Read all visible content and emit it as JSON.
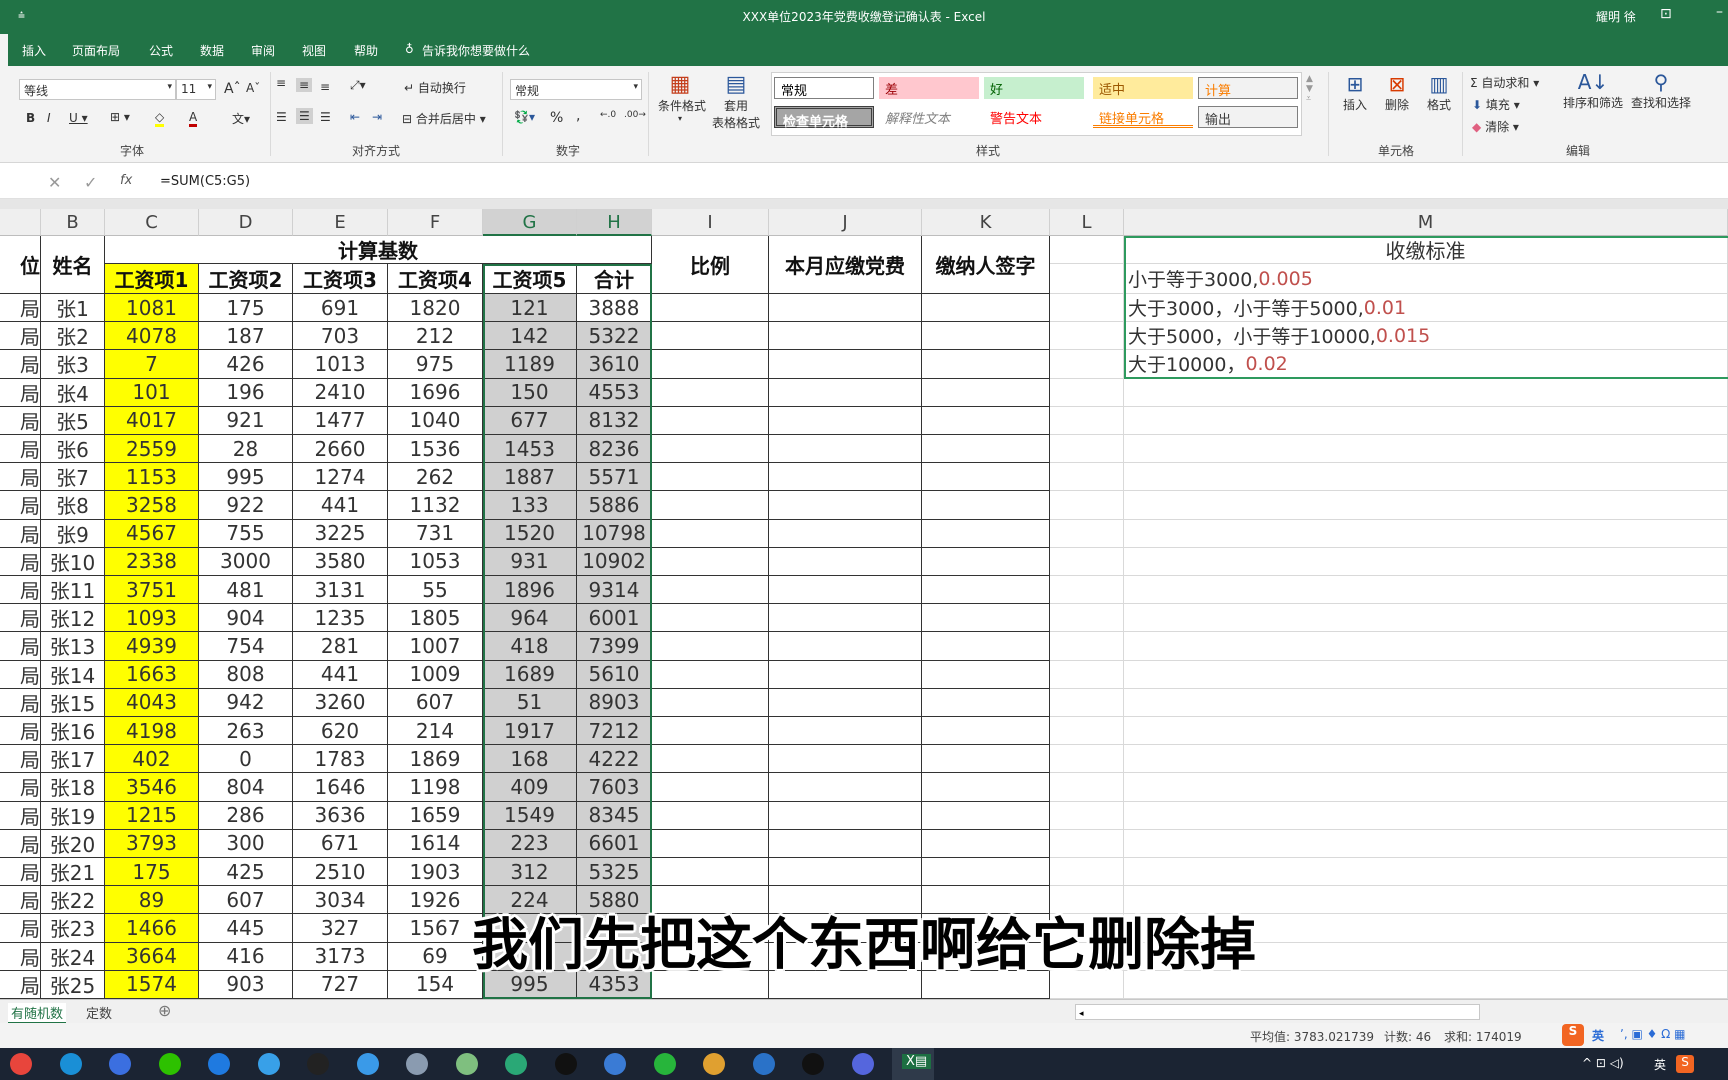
{
  "window": {
    "title": "XXX单位2023年党费收缴登记确认表  -  Excel",
    "user": "耀明 徐",
    "qat": "⩮"
  },
  "tabs": [
    "插入",
    "页面布局",
    "公式",
    "数据",
    "审阅",
    "视图",
    "帮助"
  ],
  "tell_me": "告诉我你想要做什么",
  "ribbon": {
    "font_name": "等线",
    "font_size": "11",
    "wrap_text": "自动换行",
    "merge_center": "合并后居中",
    "number_format": "常规",
    "cond_format": "条件格式",
    "table_format_1": "套用",
    "table_format_2": "表格格式",
    "styles": [
      {
        "label": "常规",
        "bg": "#ffffff",
        "fg": "#000000"
      },
      {
        "label": "差",
        "bg": "#ffc7ce",
        "fg": "#9c0006"
      },
      {
        "label": "好",
        "bg": "#c6efce",
        "fg": "#006100"
      },
      {
        "label": "适中",
        "bg": "#ffeb9c",
        "fg": "#9c5700"
      },
      {
        "label": "计算",
        "bg": "#f2f2f2",
        "fg": "#fa7d00"
      },
      {
        "label": "检查单元格",
        "bg": "#a5a5a5",
        "fg": "#ffffff"
      },
      {
        "label": "解释性文本",
        "bg": "#ffffff",
        "fg": "#7f7f7f"
      },
      {
        "label": "警告文本",
        "bg": "#ffffff",
        "fg": "#ff0000"
      },
      {
        "label": "链接单元格",
        "bg": "#ffffff",
        "fg": "#fa7d00"
      },
      {
        "label": "输出",
        "bg": "#f2f2f2",
        "fg": "#3f3f3f"
      }
    ],
    "insert": "插入",
    "delete": "删除",
    "format": "格式",
    "autosum": "自动求和",
    "fill": "填充",
    "clear": "清除",
    "sort_filter": "排序和筛选",
    "find_select": "查找和选择",
    "groups": {
      "font": "字体",
      "align": "对齐方式",
      "number": "数字",
      "styles": "样式",
      "cells": "单元格",
      "editing": "编辑"
    }
  },
  "formula_bar": {
    "fx": "fx",
    "formula": "=SUM(C5:G5)"
  },
  "sheet": {
    "columns": [
      "",
      "B",
      "C",
      "D",
      "E",
      "F",
      "G",
      "H",
      "I",
      "J",
      "K",
      "L",
      "M"
    ],
    "header": {
      "unit": "位",
      "name": "姓名",
      "group": "计算基数",
      "items": [
        "工资项1",
        "工资项2",
        "工资项3",
        "工资项4",
        "工资项5",
        "合计"
      ],
      "ratio": "比例",
      "due": "本月应缴党费",
      "sign": "缴纳人签字",
      "standard": "收缴标准"
    },
    "rules": [
      {
        "text": "小于等于3000,",
        "rate": "0.005"
      },
      {
        "text": "大于3000，小于等于5000,",
        "rate": "0.01"
      },
      {
        "text": "大于5000，小于等于10000,",
        "rate": "0.015"
      },
      {
        "text": "大于10000，",
        "rate": "0.02"
      }
    ],
    "rows": [
      {
        "unit": "局",
        "name": "张1",
        "v": [
          1081,
          175,
          691,
          1820,
          121,
          3888
        ]
      },
      {
        "unit": "局",
        "name": "张2",
        "v": [
          4078,
          187,
          703,
          212,
          142,
          5322
        ]
      },
      {
        "unit": "局",
        "name": "张3",
        "v": [
          7,
          426,
          1013,
          975,
          1189,
          3610
        ]
      },
      {
        "unit": "局",
        "name": "张4",
        "v": [
          101,
          196,
          2410,
          1696,
          150,
          4553
        ]
      },
      {
        "unit": "局",
        "name": "张5",
        "v": [
          4017,
          921,
          1477,
          1040,
          677,
          8132
        ]
      },
      {
        "unit": "局",
        "name": "张6",
        "v": [
          2559,
          28,
          2660,
          1536,
          1453,
          8236
        ]
      },
      {
        "unit": "局",
        "name": "张7",
        "v": [
          1153,
          995,
          1274,
          262,
          1887,
          5571
        ]
      },
      {
        "unit": "局",
        "name": "张8",
        "v": [
          3258,
          922,
          441,
          1132,
          133,
          5886
        ]
      },
      {
        "unit": "局",
        "name": "张9",
        "v": [
          4567,
          755,
          3225,
          731,
          1520,
          10798
        ]
      },
      {
        "unit": "局",
        "name": "张10",
        "v": [
          2338,
          3000,
          3580,
          1053,
          931,
          10902
        ]
      },
      {
        "unit": "局",
        "name": "张11",
        "v": [
          3751,
          481,
          3131,
          55,
          1896,
          9314
        ]
      },
      {
        "unit": "局",
        "name": "张12",
        "v": [
          1093,
          904,
          1235,
          1805,
          964,
          6001
        ]
      },
      {
        "unit": "局",
        "name": "张13",
        "v": [
          4939,
          754,
          281,
          1007,
          418,
          7399
        ]
      },
      {
        "unit": "局",
        "name": "张14",
        "v": [
          1663,
          808,
          441,
          1009,
          1689,
          5610
        ]
      },
      {
        "unit": "局",
        "name": "张15",
        "v": [
          4043,
          942,
          3260,
          607,
          51,
          8903
        ]
      },
      {
        "unit": "局",
        "name": "张16",
        "v": [
          4198,
          263,
          620,
          214,
          1917,
          7212
        ]
      },
      {
        "unit": "局",
        "name": "张17",
        "v": [
          402,
          0,
          1783,
          1869,
          168,
          4222
        ]
      },
      {
        "unit": "局",
        "name": "张18",
        "v": [
          3546,
          804,
          1646,
          1198,
          409,
          7603
        ]
      },
      {
        "unit": "局",
        "name": "张19",
        "v": [
          1215,
          286,
          3636,
          1659,
          1549,
          8345
        ]
      },
      {
        "unit": "局",
        "name": "张20",
        "v": [
          3793,
          300,
          671,
          1614,
          223,
          6601
        ]
      },
      {
        "unit": "局",
        "name": "张21",
        "v": [
          175,
          425,
          2510,
          1903,
          312,
          5325
        ]
      },
      {
        "unit": "局",
        "name": "张22",
        "v": [
          89,
          607,
          3034,
          1926,
          224,
          5880
        ]
      },
      {
        "unit": "局",
        "name": "张23",
        "v": [
          1466,
          445,
          327,
          1567,
          null,
          null
        ]
      },
      {
        "unit": "局",
        "name": "张24",
        "v": [
          3664,
          416,
          3173,
          69,
          null,
          null
        ]
      },
      {
        "unit": "局",
        "name": "张25",
        "v": [
          1574,
          903,
          727,
          154,
          995,
          4353
        ]
      }
    ]
  },
  "caption": "我们先把这个东西啊给它删除掉",
  "sheet_tabs": [
    "有随机数",
    "定数"
  ],
  "status": {
    "average": "平均值: 3783.021739",
    "count": "计数: 46",
    "sum": "求和: 174019",
    "ime": "英"
  },
  "taskbar": {
    "ime": "英"
  },
  "colors": {
    "excel_green": "#217346",
    "highlight_yellow": "#ffff00",
    "selection_gray": "#d0d0d0",
    "rate_red": "#c0504d"
  }
}
